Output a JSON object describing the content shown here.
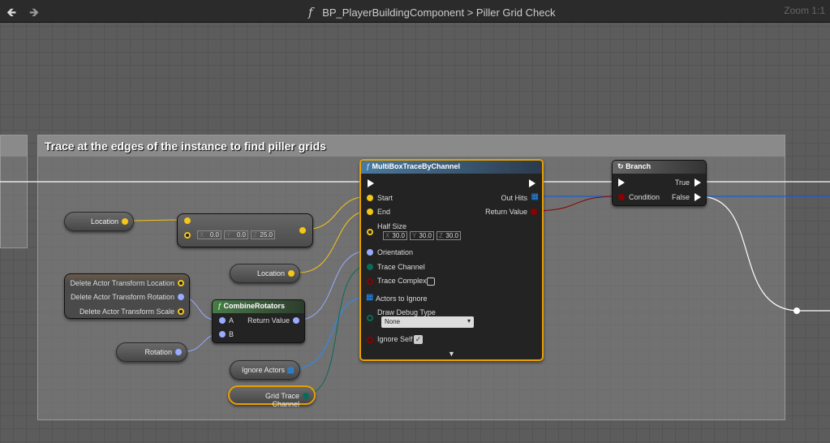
{
  "header": {
    "back_icon": "arrow-left",
    "forward_icon": "arrow-right",
    "function_icon": "f",
    "path": "BP_PlayerBuildingComponent",
    "separator": ">",
    "graph": "Piller Grid Check",
    "zoom": "Zoom 1:1"
  },
  "comment": {
    "title": "Trace at the edges of the instance to find piller grids"
  },
  "vars": {
    "location1": "Location",
    "location2": "Location",
    "rotation": "Rotation",
    "ignore_actors": "Ignore Actors",
    "grid_trace_channel": "Grid Trace Channel"
  },
  "break_node": {
    "rows": [
      "Delete Actor Transform Location",
      "Delete Actor Transform Rotation",
      "Delete Actor Transform Scale"
    ]
  },
  "add_node": {
    "x": "0.0",
    "y": "0.0",
    "z": "25.0"
  },
  "combine": {
    "title": "CombineRotators",
    "a": "A",
    "b": "B",
    "ret": "Return Value"
  },
  "trace": {
    "title": "MultiBoxTraceByChannel",
    "start": "Start",
    "end": "End",
    "half_size": "Half Size",
    "hx": "30.0",
    "hy": "30.0",
    "hz": "30.0",
    "orientation": "Orientation",
    "trace_channel": "Trace Channel",
    "trace_complex": "Trace Complex",
    "trace_complex_checked": false,
    "actors_to_ignore": "Actors to Ignore",
    "draw_debug_type": "Draw Debug Type",
    "draw_debug_value": "None",
    "ignore_self": "Ignore Self",
    "ignore_self_checked": true,
    "out_hits": "Out Hits",
    "return_value": "Return Value"
  },
  "branch": {
    "title": "Branch",
    "condition": "Condition",
    "true": "True",
    "false": "False"
  },
  "axis": {
    "x": "X",
    "y": "Y",
    "z": "Z"
  },
  "colors": {
    "vector": "#f5c518",
    "rotator": "#99aaff",
    "bool": "#8c0000",
    "array": "#1e90ff",
    "channel": "#0a6a5a",
    "exec": "#ffffff"
  }
}
